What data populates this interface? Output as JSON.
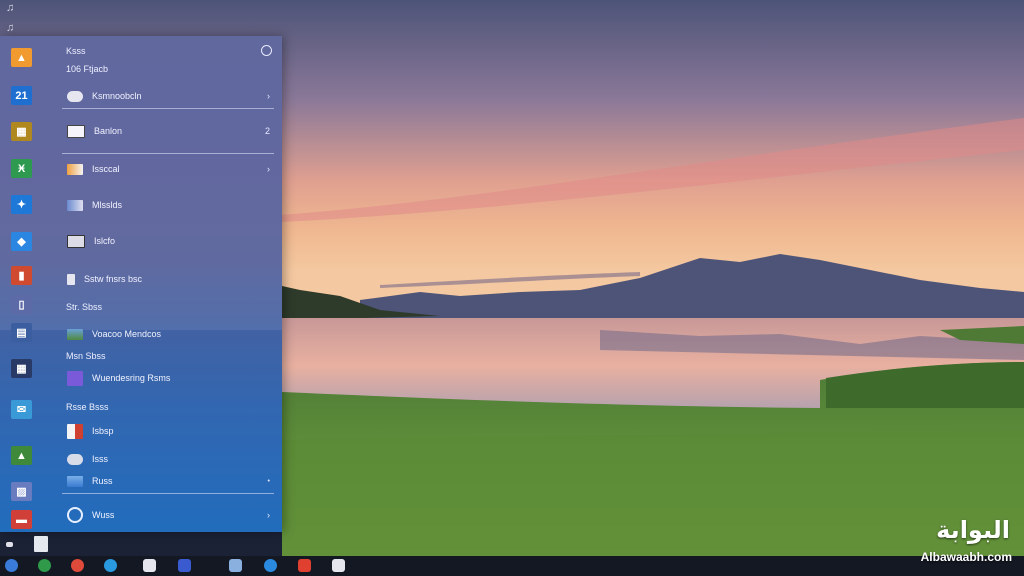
{
  "desktop": {
    "glyph_top": "♫",
    "glyph_second": "♫"
  },
  "start_menu": {
    "header": "Ksss",
    "subheader": "106 Ftjacb",
    "items": [
      {
        "label": "Ksmnoobcln",
        "icon": "cloud-icon"
      },
      {
        "label": "Banlon",
        "icon": "window-icon"
      },
      {
        "label": "Issccal",
        "icon": "picture-icon"
      },
      {
        "label": "Mlsslds",
        "icon": "image-icon"
      },
      {
        "label": "Islcfo",
        "icon": "camera-icon"
      }
    ],
    "section_items": [
      {
        "label": "Sstw fnsrs bsc",
        "icon": "doc-icon"
      },
      {
        "label": "Voacoo Mendcos",
        "icon": "landscape-icon"
      },
      {
        "label": "Wuendesring Rsms",
        "icon": "purple-app-icon"
      },
      {
        "label": "Isbsp",
        "icon": "red-app-icon"
      },
      {
        "label": "Isss",
        "icon": "cloud-icon"
      },
      {
        "label": "Russ",
        "icon": "blue-app-icon"
      },
      {
        "label": "Wuss",
        "icon": "edge-icon"
      }
    ],
    "section_labels": [
      "Str. Sbss",
      "Msn Sbss",
      "Rsse Bsss"
    ],
    "chevron": "›",
    "chevron_alt": "2"
  },
  "watermark": {
    "arabic": "البوابة",
    "latin": "Albawaabh.com"
  },
  "colors": {
    "menu_tint": "#5a64a0",
    "taskbar": "#141822",
    "accent_orange": "#f0a030",
    "accent_blue": "#1e78d0"
  }
}
